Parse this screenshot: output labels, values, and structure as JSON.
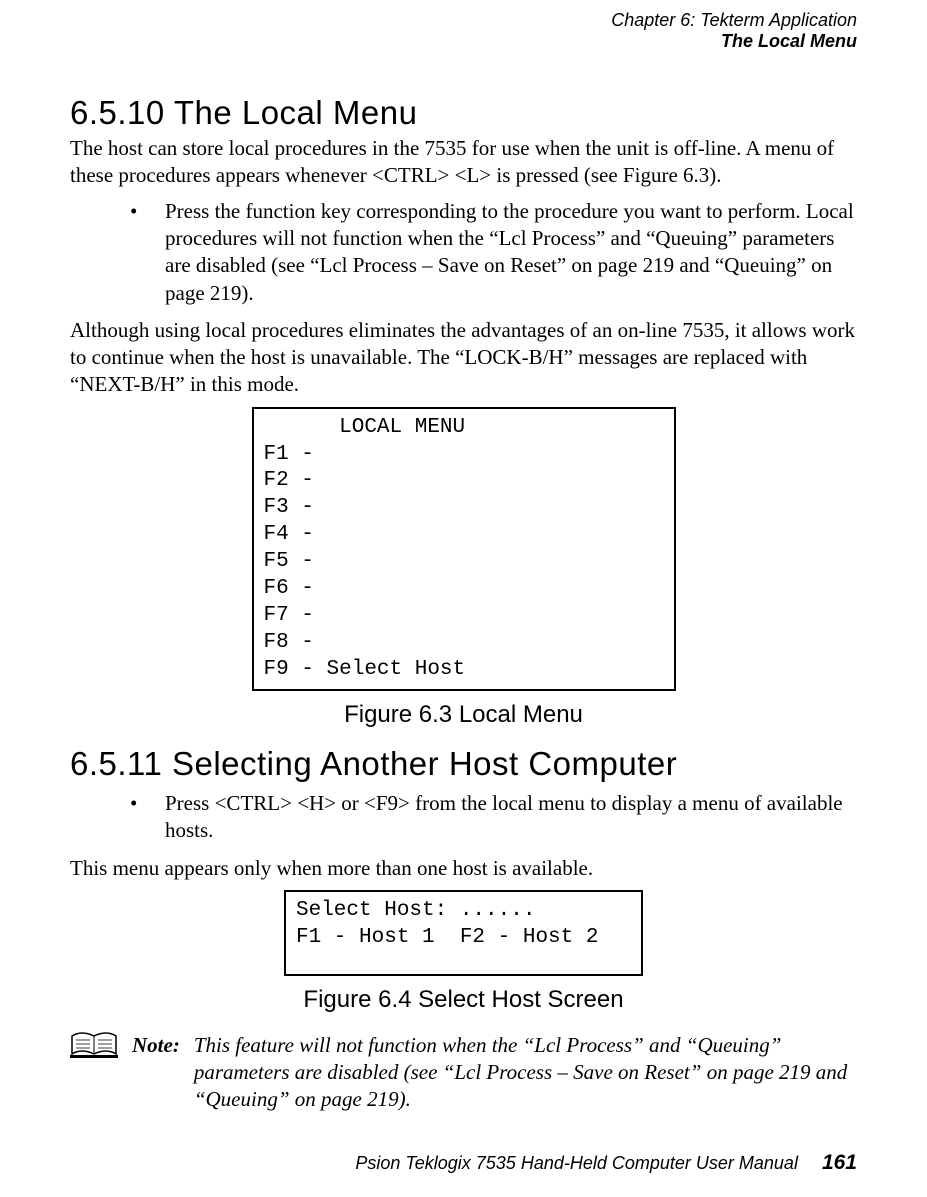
{
  "header": {
    "chapter": "Chapter 6: Tekterm Application",
    "section_title": "The Local Menu"
  },
  "s6510": {
    "heading": "6.5.10  The Local Menu",
    "p1": "The host can store local procedures in the 7535 for use when the unit is off-line. A menu of these procedures appears whenever  <CTRL> <L> is pressed (see Figure 6.3).",
    "bullet1": "Press the function key corresponding to the procedure you want to perform. Local procedures will not function when the “Lcl Process” and “Queuing” parameters are disabled (see “Lcl Process – Save on Reset” on page 219 and “Queuing” on page 219).",
    "p2": "Although using local procedures eliminates the advantages of an on-line 7535, it allows work to continue when the host is unavailable. The “LOCK-B/H” messages are replaced with “NEXT-B/H” in this mode.",
    "terminal": "      LOCAL MENU\nF1 -\nF2 -\nF3 -\nF4 -\nF5 -\nF6 -\nF7 -\nF8 -\nF9 - Select Host",
    "caption": "Figure 6.3 Local Menu"
  },
  "s6511": {
    "heading": "6.5.11  Selecting Another Host Computer",
    "bullet1": "Press  <CTRL> <H> or <F9> from the local menu to display a menu of available hosts.",
    "p1": "This menu appears only when more than one host is available.",
    "terminal": "Select Host: ......\nF1 - Host 1  F2 - Host 2",
    "caption": "Figure 6.4 Select Host Screen"
  },
  "note": {
    "label": "Note:",
    "text": "This feature will not function when the “Lcl Process” and “Queuing” parameters are disabled (see “Lcl Process – Save on Reset” on page 219 and “Queuing” on page 219)."
  },
  "footer": {
    "manual": "Psion Teklogix 7535 Hand-Held Computer User Manual",
    "page": "161"
  }
}
